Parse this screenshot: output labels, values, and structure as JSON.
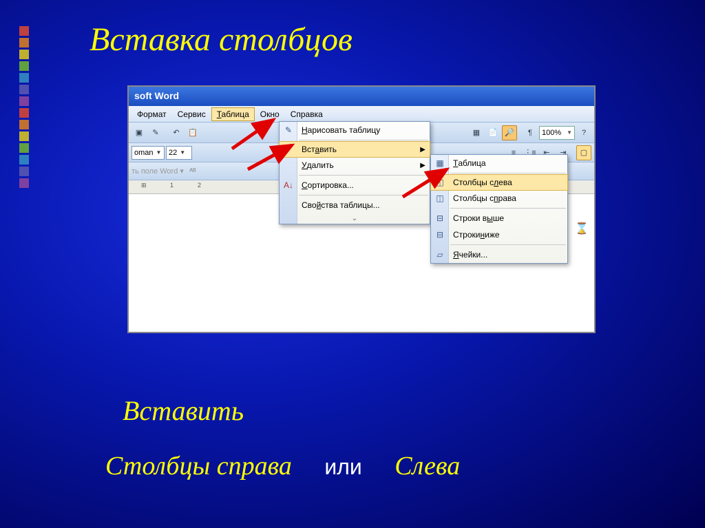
{
  "slide": {
    "title": "Вставка столбцов",
    "caption1": "Вставить",
    "caption2_left": "Столбцы справа",
    "caption2_mid": "или",
    "caption2_right": "Слева"
  },
  "bullets": [
    "#c04040",
    "#c07030",
    "#c0b030",
    "#60a040",
    "#3080c0",
    "#5050b0",
    "#8040a0",
    "#c04040",
    "#c07030",
    "#c0b030",
    "#60a040",
    "#3080c0",
    "#5050b0",
    "#8040a0"
  ],
  "word": {
    "title": "soft Word",
    "menubar": {
      "format": "Формат",
      "service": "Сервис",
      "table": "Таблица",
      "window": "Окно",
      "help": "Справка"
    },
    "zoom": "100%",
    "font": "oman",
    "size": "22",
    "fieldbar": "ть поле Word ▾",
    "menu1": {
      "draw": "Нарисовать таблицу",
      "insert": "Вставить",
      "delete": "Удалить",
      "sort": "Сортировка...",
      "props": "Свойства таблицы..."
    },
    "menu2": {
      "table": "Таблица",
      "cols_left": "Столбцы слева",
      "cols_right": "Столбцы справа",
      "rows_above": "Строки выше",
      "rows_below": "Строки ниже",
      "cells": "Ячейки..."
    }
  }
}
